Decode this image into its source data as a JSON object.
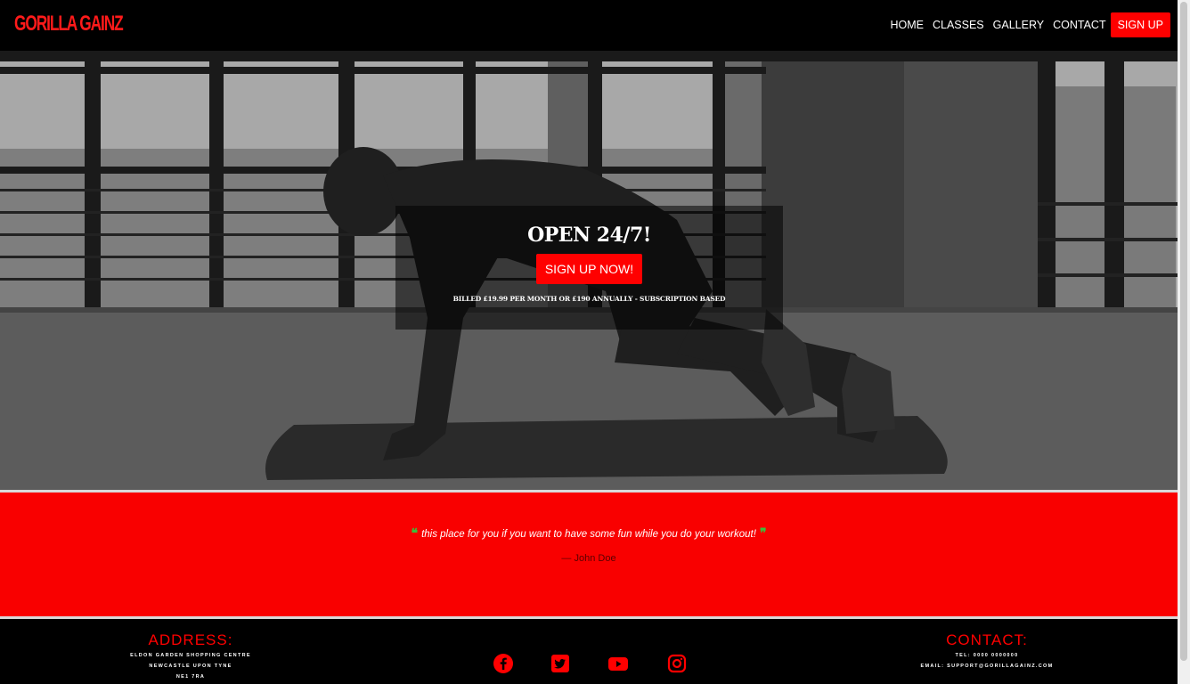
{
  "nav": {
    "brand": "GORILLA GAINZ",
    "links": [
      "HOME",
      "CLASSES",
      "GALLERY",
      "CONTACT"
    ],
    "signup": "SIGN UP"
  },
  "hero": {
    "title": "OPEN 24/7!",
    "button": "SIGN UP NOW!",
    "note": "BILLED £19.99 PER MONTH OR £190 ANNUALLY - SUBSCRIPTION BASED"
  },
  "testimonial": {
    "quote": "this place for you if you want to have some fun while you do your workout!",
    "author": "— John Doe"
  },
  "footer": {
    "address_heading": "ADDRESS:",
    "address_lines": [
      "ELDON GARDEN SHOPPING CENTRE",
      "NEWCASTLE UPON TYNE",
      "NE1 7RA"
    ],
    "contact_heading": "CONTACT:",
    "tel": "TEL: 0000 0000000",
    "email": "EMAIL: SUPPORT@GORILLAGAINZ.COM",
    "social_icons": [
      "facebook-icon",
      "twitter-icon",
      "youtube-icon",
      "instagram-icon"
    ]
  },
  "colors": {
    "accent": "#ff0000",
    "navbar": "#000000",
    "quote_mark": "#3bbf3b"
  }
}
